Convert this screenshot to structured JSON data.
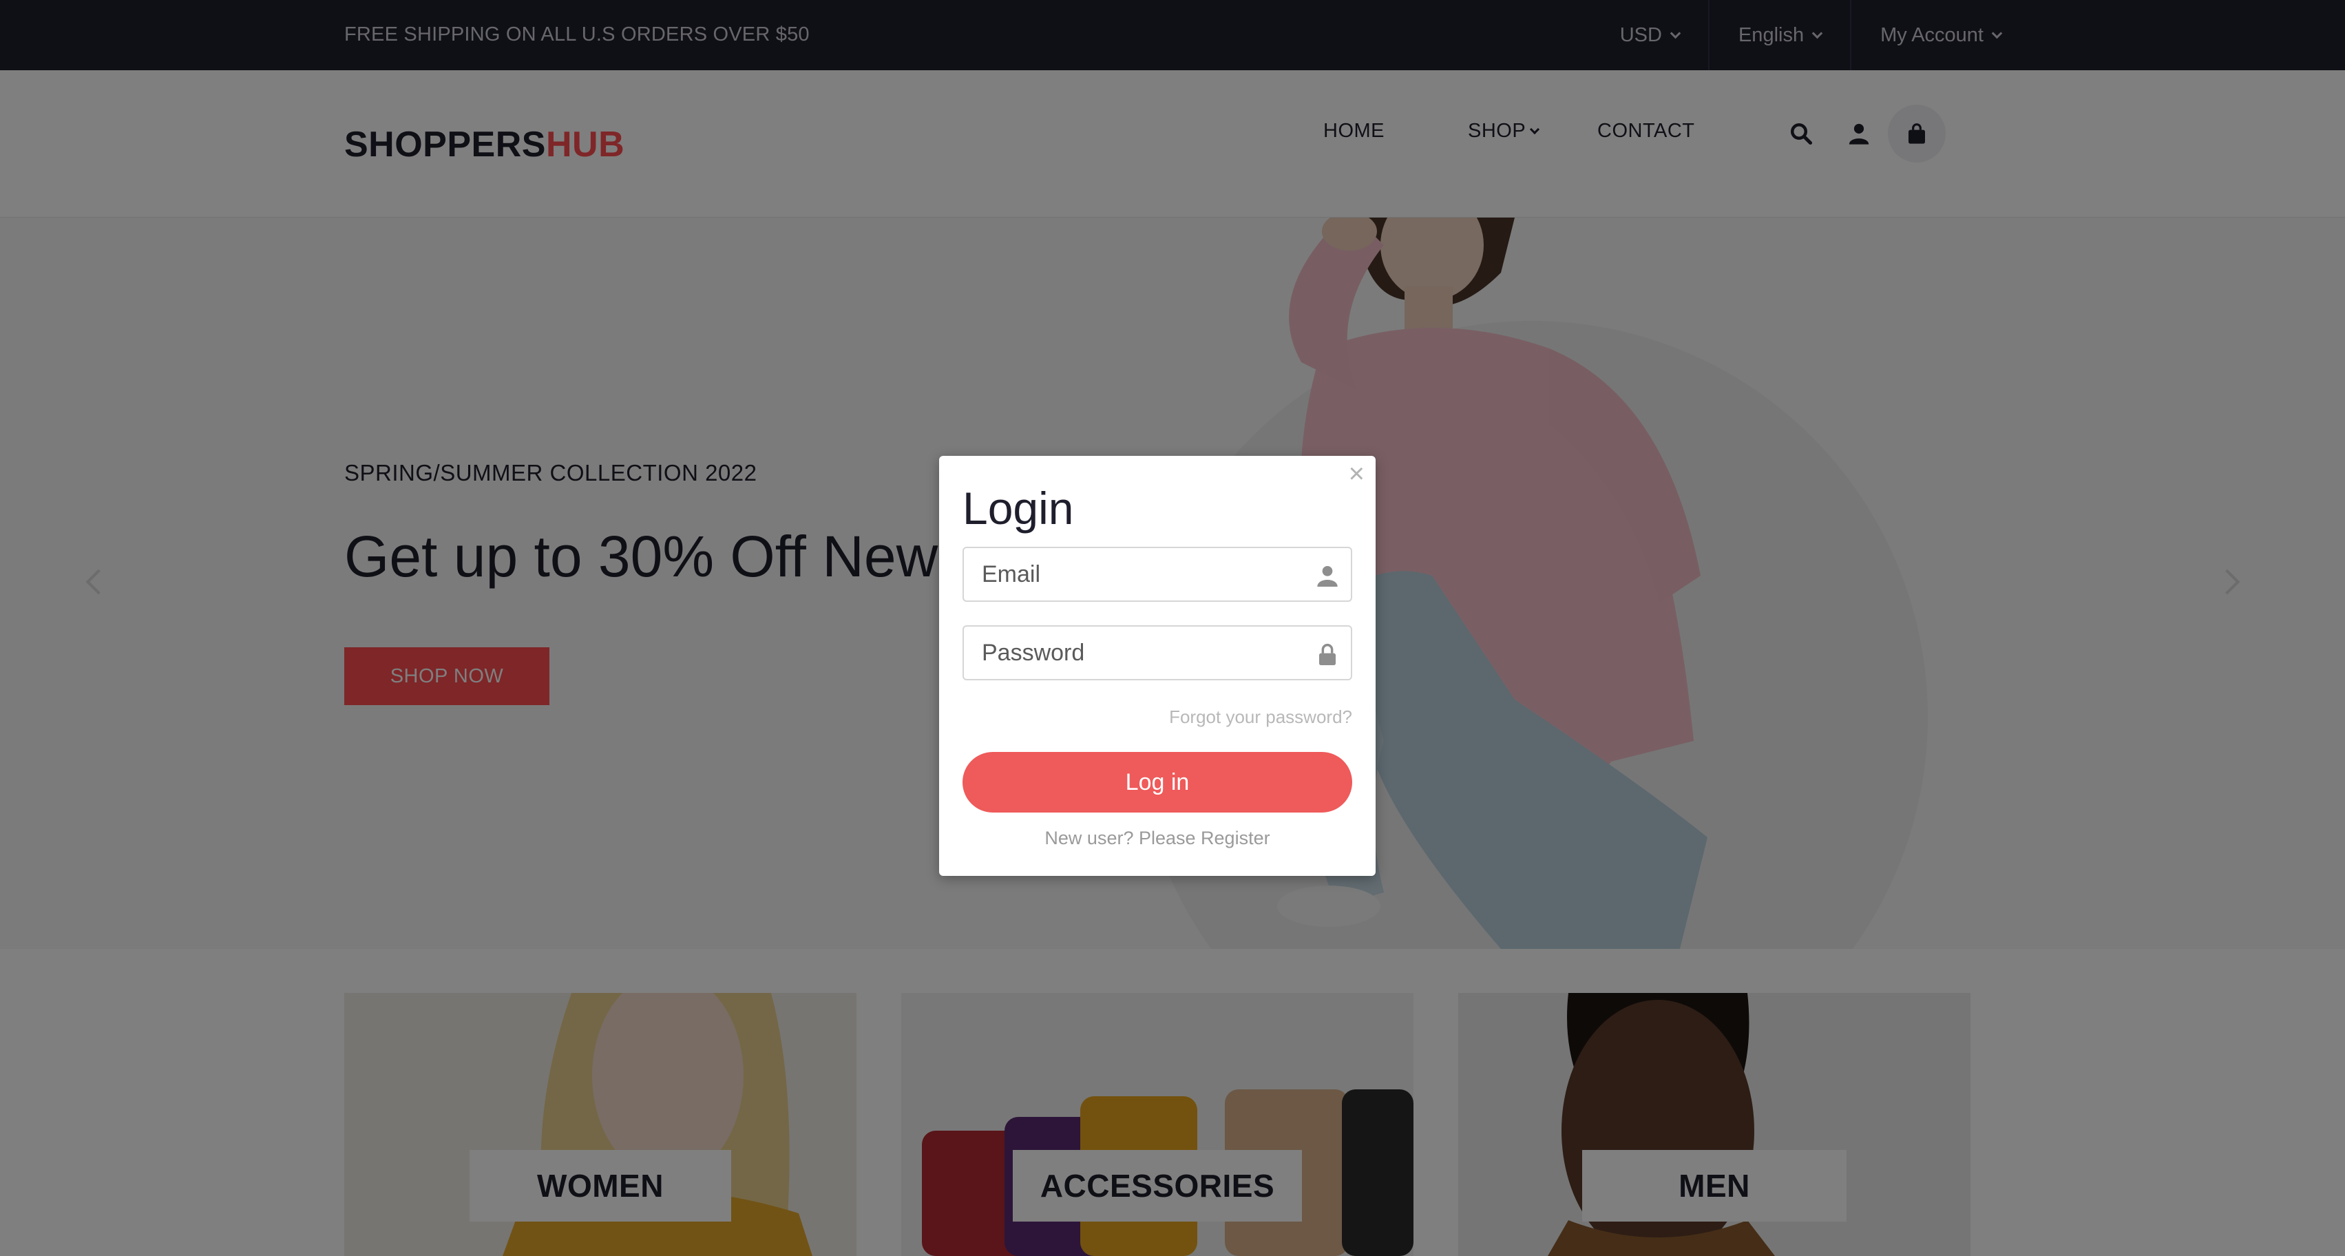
{
  "topbar": {
    "shipping_text": "FREE SHIPPING ON ALL U.S ORDERS OVER $50",
    "currency": "USD",
    "language": "English",
    "account": "My Account"
  },
  "header": {
    "logo_part1": "SHOPPERS",
    "logo_part2": "HUB",
    "nav": {
      "home": "HOME",
      "shop": "SHOP",
      "contact": "CONTACT"
    }
  },
  "hero": {
    "subtitle": "SPRING/SUMMER COLLECTION 2022",
    "headline": "Get up to 30% Off New",
    "cta": "SHOP NOW"
  },
  "categories": [
    {
      "label": "WOMEN"
    },
    {
      "label": "ACCESSORIES"
    },
    {
      "label": "MEN"
    }
  ],
  "login_modal": {
    "close": "×",
    "title": "Login",
    "email_placeholder": "Email",
    "password_placeholder": "Password",
    "forgot": "Forgot your password?",
    "login_button": "Log in",
    "register": "New user? Please Register"
  },
  "colors": {
    "accent": "#fe4c50",
    "dark": "#1e1e2c",
    "login_button": "#ef5a5a"
  }
}
